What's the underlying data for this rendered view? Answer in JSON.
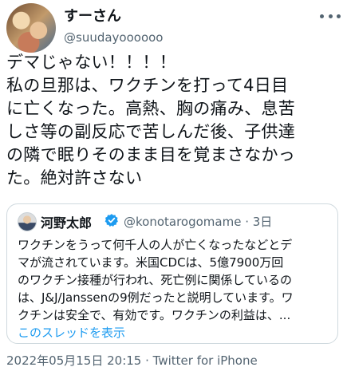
{
  "author": {
    "display_name": "すーさん",
    "handle": "@suudayoooooo"
  },
  "tweet": {
    "lines": [
      "デマじゃない！！！！",
      "私の旦那は、ワクチンを打って4日目",
      "に亡くなった。高熱、胸の痛み、息苦",
      "しさ等の副反応で苦しんだ後、子供達",
      "の隣で眠りそのまま目を覚まさなかっ",
      "た。絶対許さない"
    ]
  },
  "quote": {
    "name": "河野太郎",
    "handle_time": "@konotarogomame · 3日",
    "lines": [
      "ワクチンをうって何千人の人が亡くなったなどとデ",
      "マが流されています。米国CDCは、5億7900万回",
      "のワクチン接種が行われ、死亡例に関係しているの",
      "は、J&J/Janssenの9例だったと説明しています。ワ",
      "クチンは安全で、有効です。ワクチンの利益は、..."
    ],
    "thread_link": "このスレッドを表示"
  },
  "footer": {
    "timestamp": "2022年05月15日 20:15 · Twitter for iPhone"
  },
  "colors": {
    "text": "#0f1419",
    "secondary": "#536471",
    "link": "#1d9bf0",
    "verified": "#1d9bf0",
    "border": "#cfd9de"
  },
  "icons": [
    "more-icon",
    "verified-icon"
  ]
}
